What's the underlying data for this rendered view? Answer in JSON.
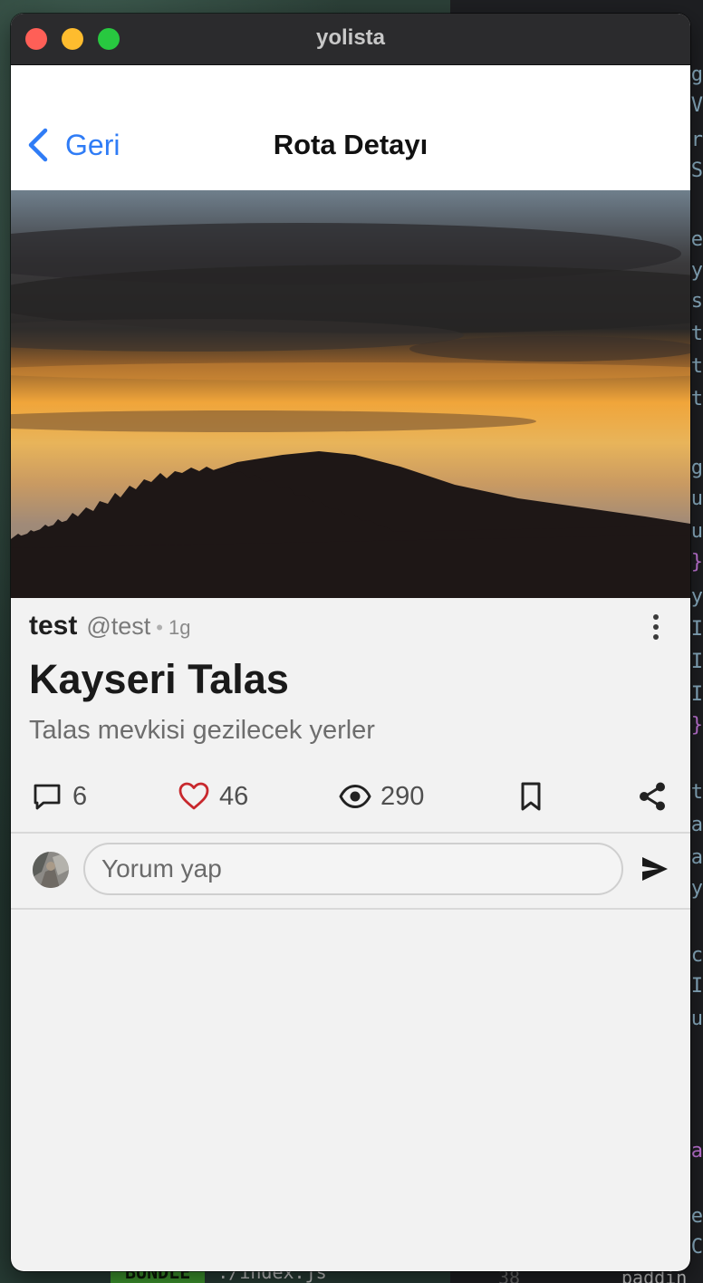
{
  "window": {
    "title": "yolista"
  },
  "nav": {
    "back_label": "Geri",
    "title": "Rota Detayı"
  },
  "post": {
    "author": "test",
    "handle": "@test",
    "age": "1g",
    "title": "Kayseri Talas",
    "subtitle": "Talas mevkisi gezilecek yerler"
  },
  "stats": {
    "comments": "6",
    "likes": "46",
    "views": "290"
  },
  "comment_box": {
    "placeholder": "Yorum yap"
  },
  "editor": {
    "snippets": [
      "ag",
      "V",
      "or",
      "S",
      "me",
      "ty",
      "s",
      "t",
      "t",
      "t",
      "ag",
      "ou",
      "u",
      "}",
      "ty",
      "I",
      "I",
      "I",
      "}",
      "xt",
      "la",
      "la",
      "ty",
      "uc",
      "I",
      "ou",
      "fa",
      "le",
      "C"
    ],
    "bundle_tag": "BUNDLE",
    "file": "./index.js",
    "line_number": "38",
    "code_word": "paddin"
  },
  "colors": {
    "accent": "#2f7cf6",
    "like": "#c8282d",
    "text": "#1f1f1f"
  },
  "icons": [
    "chevron-left-icon",
    "more-vertical-icon",
    "comment-icon",
    "heart-icon",
    "eye-icon",
    "bookmark-icon",
    "share-icon",
    "send-icon"
  ]
}
